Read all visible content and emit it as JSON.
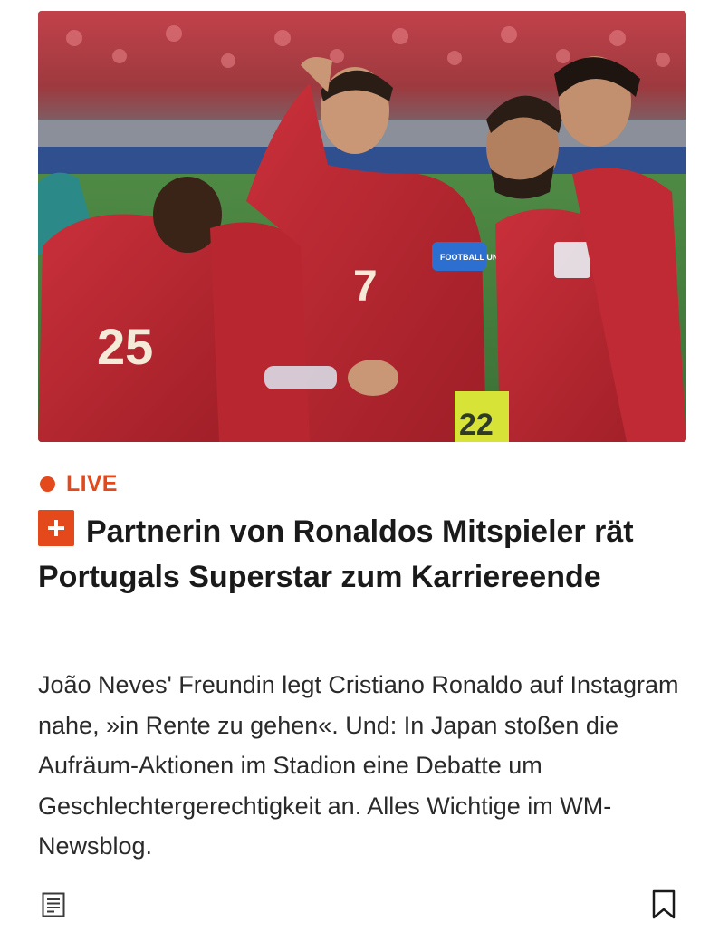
{
  "article": {
    "image_alt": "Portugal players in red jerseys on the pitch",
    "live_label": "LIVE",
    "headline": "Partnerin von Ronaldos Mitspieler rät Portugals Superstar zum Karriereende",
    "teaser": "João Neves' Freundin legt Cristiano Ronaldo auf Instagram nahe, »in Rente zu gehen«. Und: In Japan stoßen die Aufräum-Aktionen im Stadion eine Debatte um Geschlechtergerechtigkeit an. Alles Wichtige im WM-Newsblog.",
    "jersey_numbers": [
      "25",
      "7",
      "22"
    ],
    "armband_text": "FOOTBALL UNITES"
  },
  "icons": {
    "plus_badge": "plus-icon",
    "article_type": "document-icon",
    "bookmark": "bookmark-icon"
  },
  "colors": {
    "accent": "#e4491b",
    "text": "#1a1a1a",
    "jersey_red": "#b5232b"
  }
}
